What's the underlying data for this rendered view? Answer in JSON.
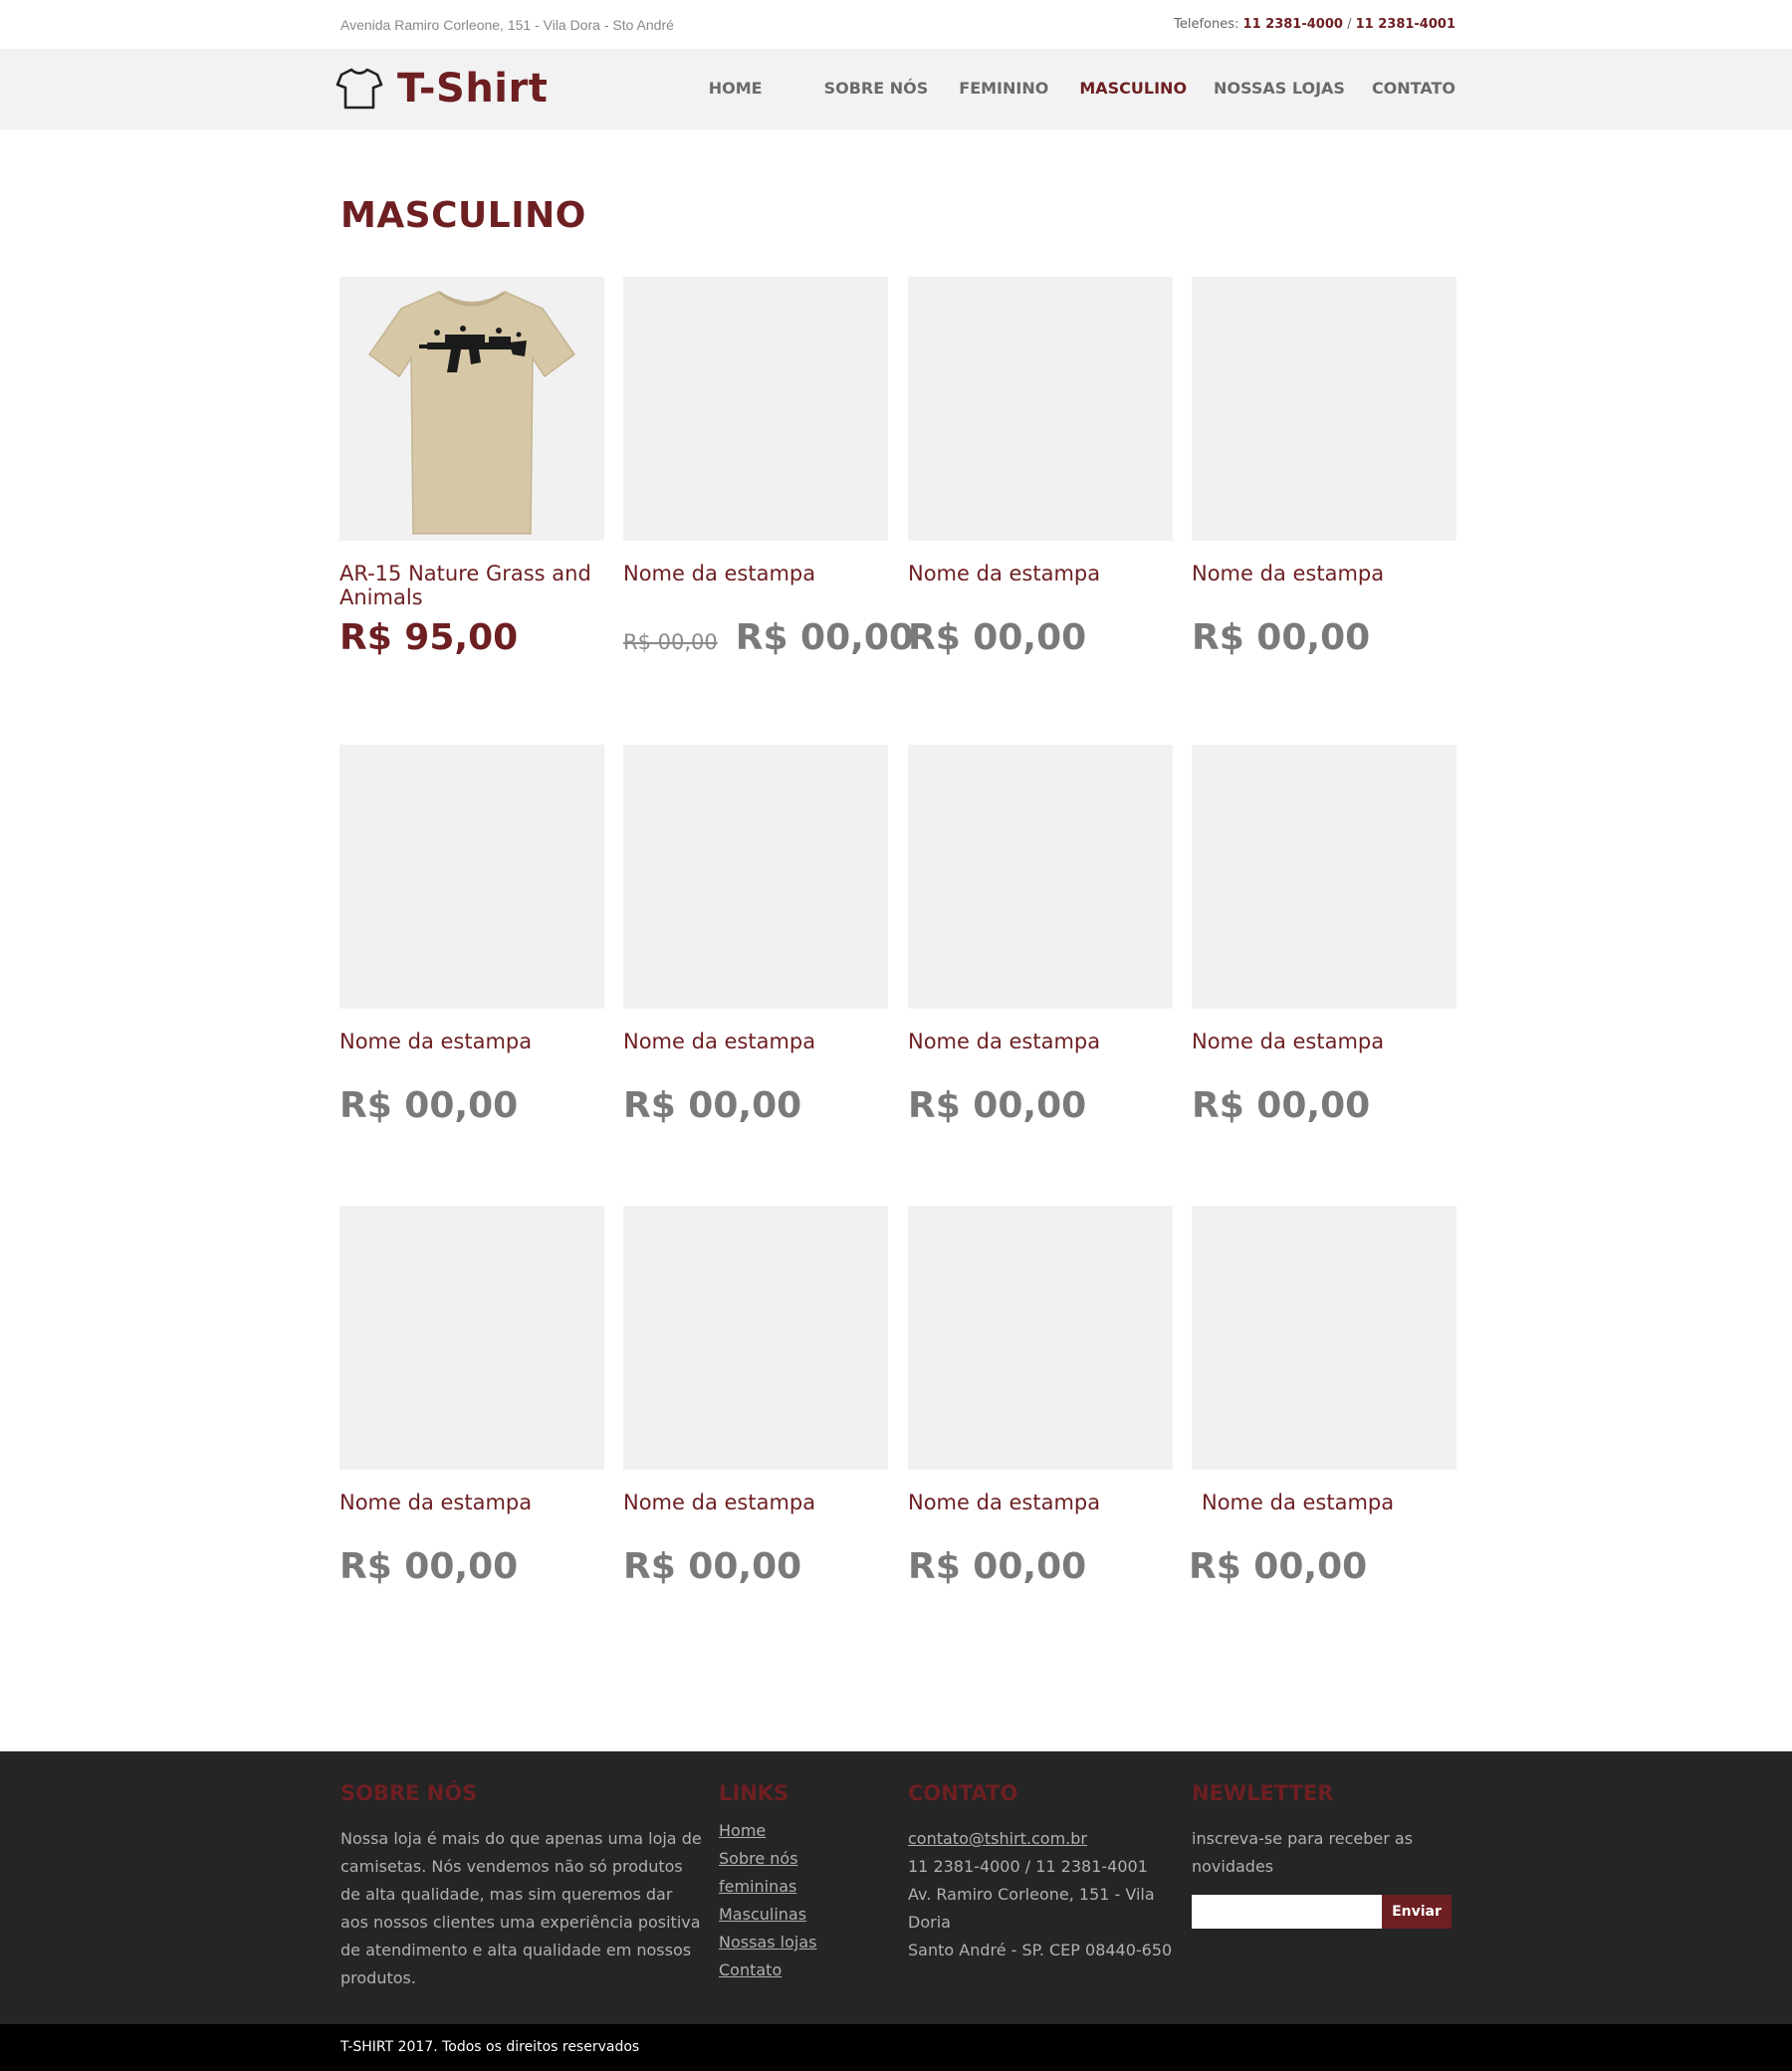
{
  "topbar": {
    "address": "Avenida Ramiro Corleone, 151 - Vila Dora - Sto André",
    "phones_label": "Telefones:",
    "phone1": "11 2381-4000",
    "separator": "/",
    "phone2": "11 2381-4001"
  },
  "header": {
    "logo_text": "T-Shirt",
    "logo_icon": "tshirt-icon",
    "nav": [
      {
        "label": "HOME"
      },
      {
        "label": "SOBRE NÓS"
      },
      {
        "label": "FEMININO"
      },
      {
        "label": "MASCULINO",
        "active": true
      },
      {
        "label": "NOSSAS LOJAS"
      },
      {
        "label": "CONTATO"
      }
    ]
  },
  "main": {
    "title": "MASCULINO",
    "products": [
      {
        "name": "AR-15 Nature Grass and Animals",
        "price": "R$ 95,00",
        "has_image": true
      },
      {
        "name": "Nome da estampa",
        "old_price": "R$ 00,00",
        "price": "R$ 00,00"
      },
      {
        "name": "Nome da estampa",
        "price": "R$ 00,00"
      },
      {
        "name": "Nome da estampa",
        "price": "R$ 00,00"
      },
      {
        "name": "Nome da estampa",
        "price": "R$ 00,00"
      },
      {
        "name": "Nome da estampa",
        "price": "R$ 00,00"
      },
      {
        "name": "Nome da estampa",
        "price": "R$ 00,00"
      },
      {
        "name": "Nome da estampa",
        "price": "R$ 00,00"
      },
      {
        "name": "Nome da estampa",
        "price": "R$ 00,00"
      },
      {
        "name": "Nome da estampa",
        "price": "R$ 00,00"
      },
      {
        "name": "Nome da estampa",
        "price": "R$ 00,00"
      },
      {
        "name": "Nome da estampa",
        "price": "R$ 00,00"
      }
    ]
  },
  "footer": {
    "about": {
      "title": "SOBRE NÓS",
      "text": "Nossa loja é mais do que apenas uma loja de camisetas. Nós vendemos não só produtos de alta qualidade, mas sim queremos dar aos nossos clientes uma experiência positiva de atendimento e alta qualidade em nossos produtos."
    },
    "links": {
      "title": "LINKS",
      "items": [
        "Home",
        "Sobre nós",
        "femininas",
        "Masculinas",
        "Nossas lojas",
        "Contato"
      ]
    },
    "contact": {
      "title": "CONTATO",
      "email": "contato@tshirt.com.br",
      "phones": "11 2381-4000 / 11 2381-4001",
      "address1": "Av. Ramiro Corleone, 151 - Vila Doria",
      "address2": "Santo André - SP. CEP 08440-650"
    },
    "newsletter": {
      "title": "NEWLETTER",
      "text": "inscreva-se para receber as novidades",
      "input_value": "",
      "button_label": "Enviar"
    }
  },
  "bottombar": {
    "copyright": "T-SHIRT 2017. Todos os direitos reservados"
  },
  "colors": {
    "brand": "#6d1f22",
    "header_bg": "#f2f2f2",
    "footer_bg": "#252525",
    "placeholder_bg": "#f1f1f1"
  }
}
